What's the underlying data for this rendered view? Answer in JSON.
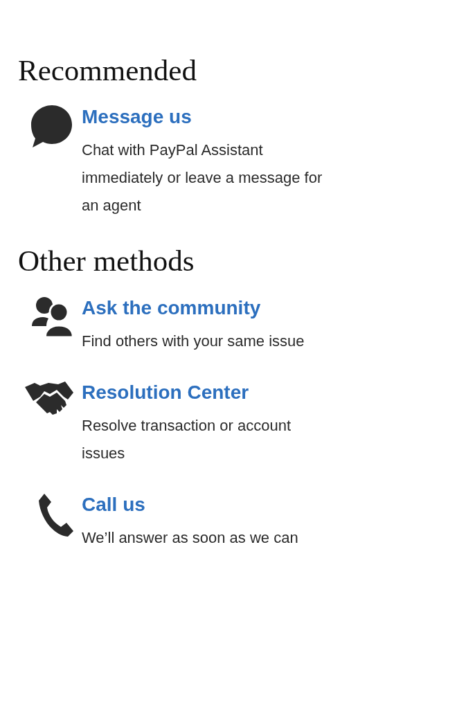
{
  "sections": [
    {
      "heading": "Recommended",
      "items": [
        {
          "kind": "chat",
          "title": "Message us",
          "description": "Chat with PayPal Assistant immediately or leave a message for an agent"
        }
      ]
    },
    {
      "heading": "Other methods",
      "items": [
        {
          "kind": "community",
          "title": "Ask the community",
          "description": "Find others with your same issue"
        },
        {
          "kind": "handshake",
          "title": "Resolution Center",
          "description": "Resolve transaction or account issues"
        },
        {
          "kind": "phone",
          "title": "Call us",
          "description": "We’ll answer as soon as we can"
        }
      ]
    }
  ]
}
